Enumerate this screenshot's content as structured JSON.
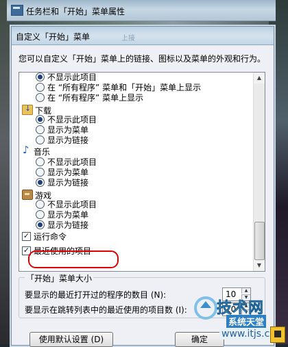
{
  "outer_window": {
    "title": "任务栏和「开始」菜单属性"
  },
  "dialog": {
    "title": "自定义「开始」菜单",
    "faint_title_text": "上接",
    "description": "您可以自定义「开始」菜单上的链接、图标以及菜单的外观和行为。",
    "list_items": [
      {
        "kind": "radio",
        "checked": true,
        "label": "不显示此项目"
      },
      {
        "kind": "radio",
        "checked": false,
        "label": "在 “所有程序” 菜单和「开始」菜单上显示"
      },
      {
        "kind": "radio",
        "checked": false,
        "label": "在 “所有程序” 菜单上显示"
      },
      {
        "kind": "category",
        "icon": "download-folder-icon",
        "label": "下载"
      },
      {
        "kind": "radio",
        "checked": true,
        "label": "不显示此项目"
      },
      {
        "kind": "radio",
        "checked": false,
        "label": "显示为菜单"
      },
      {
        "kind": "radio",
        "checked": false,
        "label": "显示为链接"
      },
      {
        "kind": "category",
        "icon": "music-note-icon",
        "label": "音乐"
      },
      {
        "kind": "radio",
        "checked": false,
        "label": "不显示此项目"
      },
      {
        "kind": "radio",
        "checked": false,
        "label": "显示为菜单"
      },
      {
        "kind": "radio",
        "checked": true,
        "label": "显示为链接"
      },
      {
        "kind": "category",
        "icon": "games-icon",
        "label": "游戏"
      },
      {
        "kind": "radio",
        "checked": false,
        "label": "不显示此项目"
      },
      {
        "kind": "radio",
        "checked": false,
        "label": "显示为菜单"
      },
      {
        "kind": "radio",
        "checked": true,
        "label": "显示为链接"
      },
      {
        "kind": "checkbox",
        "checked": true,
        "label": "运行命令"
      },
      {
        "kind": "checkbox",
        "checked": true,
        "label": "最近使用的项目"
      }
    ],
    "size_group": {
      "title": "「开始」菜单大小",
      "recent_programs_label": "要显示的最近打开过的程序的数目 (N):",
      "recent_programs_value": "10",
      "jump_list_label": "要显示在跳转列表中的最近使用的项目数 (I):",
      "jump_list_value": "10"
    },
    "buttons": {
      "defaults": "使用默认设置 (D)",
      "ok": "确定"
    }
  },
  "watermark": {
    "brand": "技术网",
    "tagline": "系统天堂",
    "url": "www.itjs.cn"
  },
  "colors": {
    "highlight_ring": "#e00000",
    "dialog_bg": "#eef0f5"
  }
}
